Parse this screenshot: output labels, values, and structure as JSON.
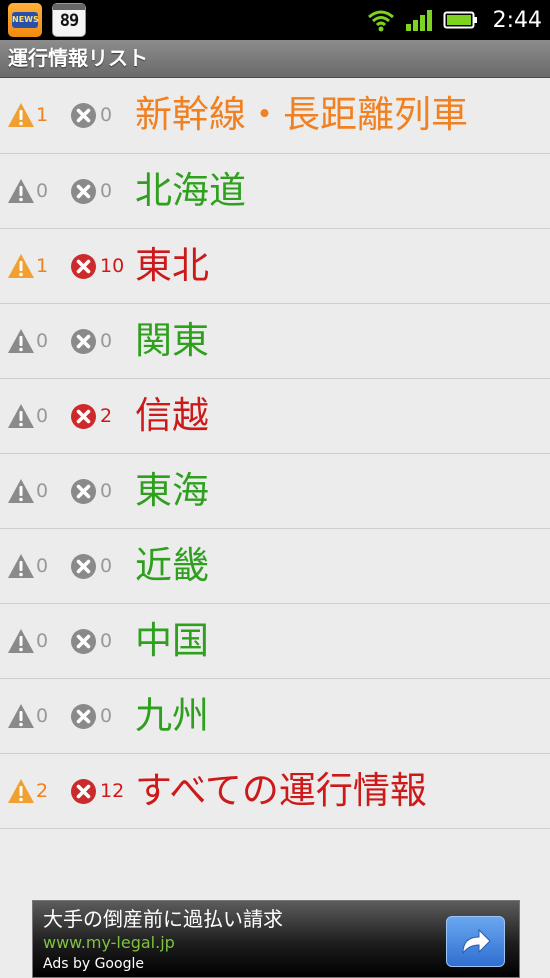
{
  "status_bar": {
    "time": "2:44",
    "notification_icons": [
      "app-notification-icon",
      "calendar-icon"
    ],
    "calendar_date": "89",
    "notification_app_badge": "NEWS",
    "system_icons": [
      "wifi-icon",
      "signal-icon",
      "battery-icon"
    ]
  },
  "title_bar": {
    "title": "運行情報リスト"
  },
  "colors": {
    "orange": "#f08020",
    "green": "#2ea01e",
    "red": "#cc1a1a",
    "gray": "#999999",
    "warning_active": "#f0a030",
    "stop_active": "#cc2b2b",
    "inactive_icon": "#8a8a8a"
  },
  "regions": [
    {
      "name": "新幹線・長距離列車",
      "warning_count": "1",
      "stop_count": "0",
      "status": "warning"
    },
    {
      "name": "北海道",
      "warning_count": "0",
      "stop_count": "0",
      "status": "normal"
    },
    {
      "name": "東北",
      "warning_count": "1",
      "stop_count": "10",
      "status": "stop"
    },
    {
      "name": "関東",
      "warning_count": "0",
      "stop_count": "0",
      "status": "normal"
    },
    {
      "name": "信越",
      "warning_count": "0",
      "stop_count": "2",
      "status": "stop"
    },
    {
      "name": "東海",
      "warning_count": "0",
      "stop_count": "0",
      "status": "normal"
    },
    {
      "name": "近畿",
      "warning_count": "0",
      "stop_count": "0",
      "status": "normal"
    },
    {
      "name": "中国",
      "warning_count": "0",
      "stop_count": "0",
      "status": "normal"
    },
    {
      "name": "九州",
      "warning_count": "0",
      "stop_count": "0",
      "status": "normal"
    },
    {
      "name": "すべての運行情報",
      "warning_count": "2",
      "stop_count": "12",
      "status": "stop"
    }
  ],
  "ad": {
    "headline": "大手の倒産前に過払い請求",
    "url": "www.my-legal.jp",
    "attribution": "Ads by Google",
    "button_icon": "share-arrow-icon"
  }
}
